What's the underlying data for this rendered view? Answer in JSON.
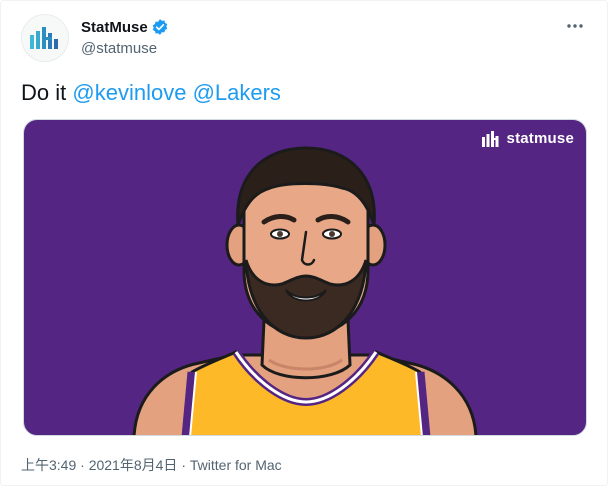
{
  "tweet": {
    "author": {
      "display_name": "StatMuse",
      "handle": "@statmuse",
      "verified": true,
      "avatar_icon": "statmuse-logo-icon"
    },
    "text": {
      "prefix": "Do it",
      "mentions": [
        "@kevinlove",
        "@Lakers"
      ]
    },
    "media": {
      "brand_text": "statmuse",
      "background_color": "#552583",
      "jersey_color": "#fdb927"
    },
    "meta": {
      "time": "上午3:49",
      "separator": "·",
      "date": "2021年8月4日",
      "source": "Twitter for Mac"
    },
    "more_icon": "more-horizontal-icon"
  },
  "colors": {
    "accent": "#1d9bf0",
    "secondary_text": "#536471",
    "logo_teal": "#3fb8d8",
    "logo_blue": "#2b6cb0"
  }
}
